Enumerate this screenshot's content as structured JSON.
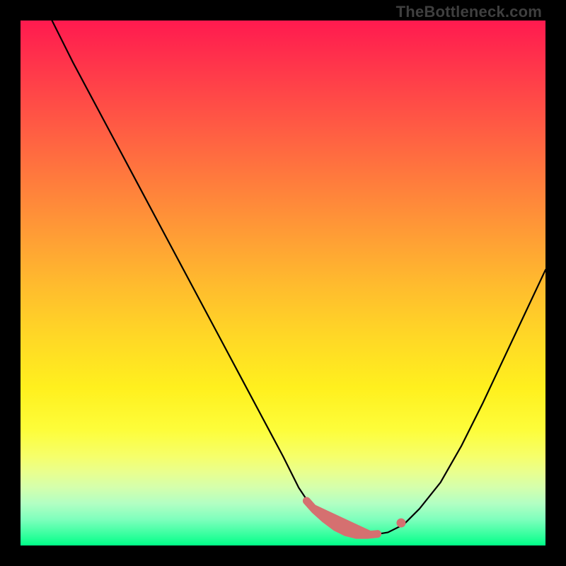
{
  "watermark": "TheBottleneck.com",
  "chart_data": {
    "type": "line",
    "title": "",
    "xlabel": "",
    "ylabel": "",
    "xlim": [
      0,
      100
    ],
    "ylim": [
      0,
      100
    ],
    "grid": false,
    "legend": false,
    "background_gradient": {
      "top": "#ff1a4f",
      "mid": "#ffd726",
      "bottom": "#00ff88"
    },
    "series": [
      {
        "name": "bottleneck-curve",
        "x": [
          6,
          8,
          10,
          14,
          18,
          22,
          26,
          30,
          34,
          38,
          42,
          46,
          50,
          53,
          55,
          57,
          60,
          62,
          64,
          67,
          70,
          73,
          76,
          80,
          84,
          88,
          92,
          96,
          100
        ],
        "y": [
          100,
          96,
          92,
          84.5,
          77,
          69.5,
          62,
          54.5,
          47,
          39.5,
          32,
          24.5,
          17,
          11,
          8,
          6,
          3.5,
          2.5,
          2,
          2,
          2.5,
          4,
          7,
          12,
          19,
          27,
          35.5,
          44,
          52.5
        ],
        "color": "#000000",
        "stroke_width": 2.2
      }
    ],
    "markers": {
      "name": "bottom-dots",
      "color": "#d57070",
      "points_x": [
        54.5,
        56,
        58,
        60,
        62,
        64,
        66,
        68,
        72.5
      ],
      "points_y": [
        8.5,
        6.8,
        5,
        3.5,
        2.5,
        2,
        2,
        2.2,
        4.3
      ]
    }
  }
}
